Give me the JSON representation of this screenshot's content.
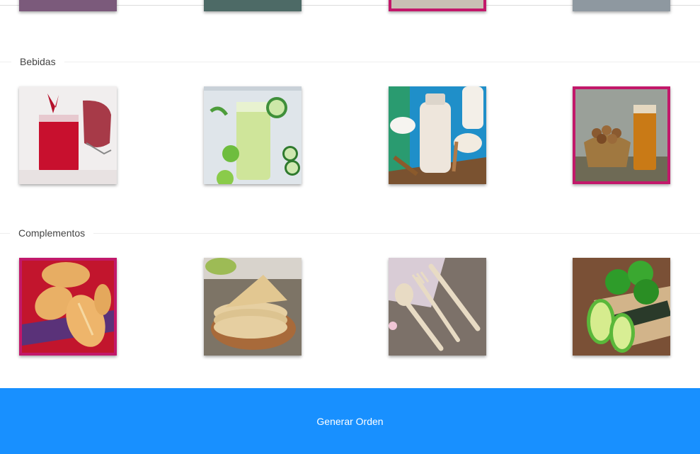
{
  "sections": [
    {
      "title": "Bebidas"
    },
    {
      "title": "Complementos"
    }
  ],
  "footer": {
    "button_label": "Generar Orden"
  },
  "colors": {
    "accent": "#1890ff",
    "selected_border": "#c2186a"
  }
}
